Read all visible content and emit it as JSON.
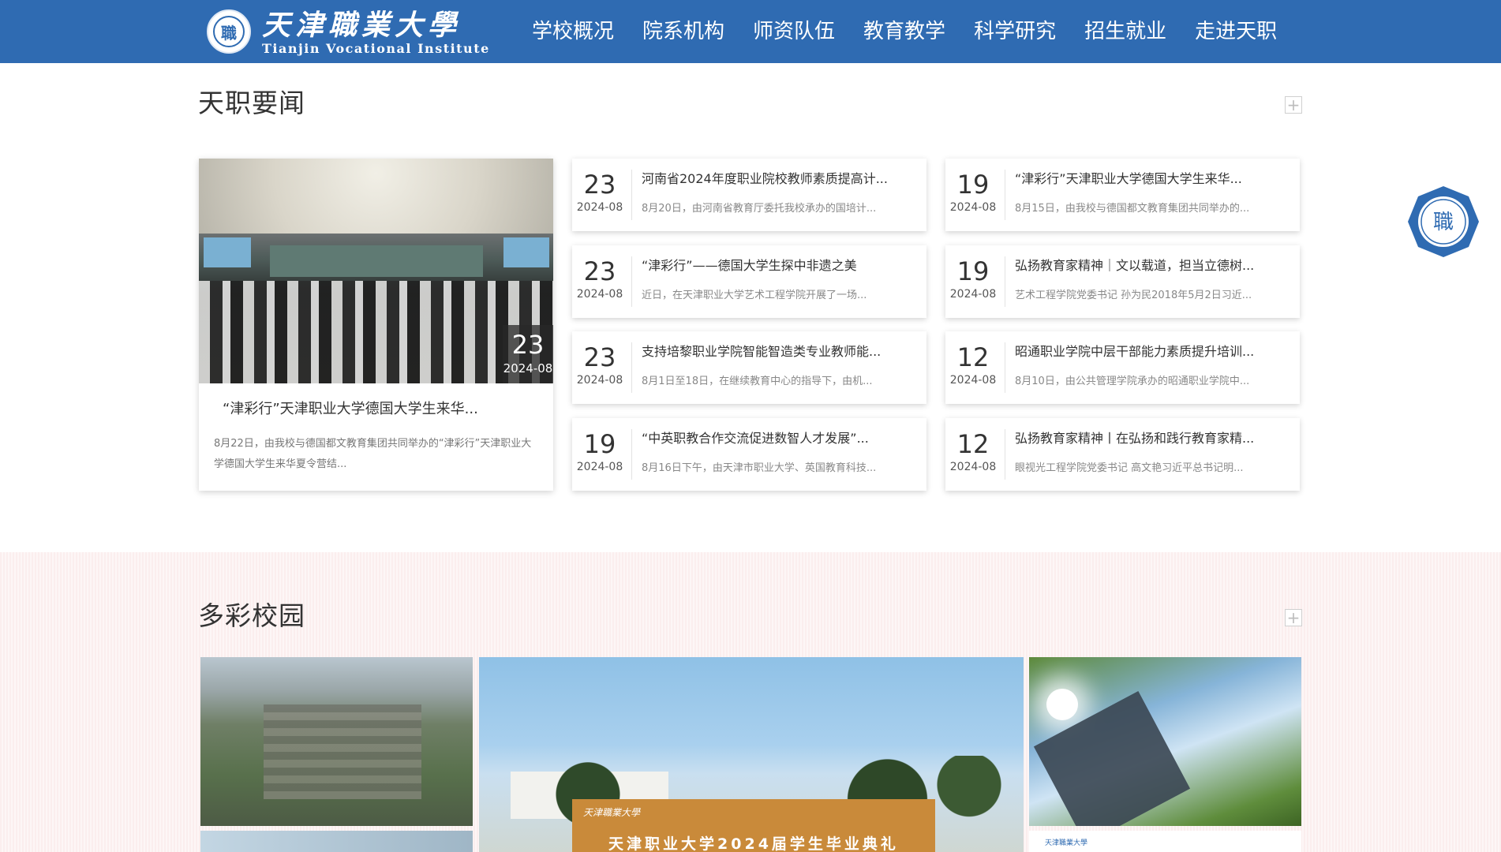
{
  "header": {
    "logo_cn": "天津職業大學",
    "logo_en": "Tianjin Vocational Institute",
    "logo_seal_char": "職",
    "nav": [
      "学校概况",
      "院系机构",
      "师资队伍",
      "教育教学",
      "科学研究",
      "招生就业",
      "走进天职"
    ]
  },
  "news_section": {
    "title": "天职要闻",
    "more": "+",
    "featured": {
      "day": "23",
      "month": "2024-08",
      "title": "“津彩行”天津职业大学德国大学生来华...",
      "summary": "8月22日，由我校与德国都文教育集团共同举办的“津彩行”天津职业大学德国大学生来华夏令营结..."
    },
    "col1": [
      {
        "day": "23",
        "month": "2024-08",
        "title": "河南省2024年度职业院校教师素质提高计...",
        "summary": "8月20日，由河南省教育厅委托我校承办的国培计..."
      },
      {
        "day": "23",
        "month": "2024-08",
        "title": "“津彩行”——德国大学生探中非遗之美",
        "summary": "近日，在天津职业大学艺术工程学院开展了一场..."
      },
      {
        "day": "23",
        "month": "2024-08",
        "title": "支持培黎职业学院智能智造类专业教师能...",
        "summary": "8月1日至18日，在继续教育中心的指导下，由机..."
      },
      {
        "day": "19",
        "month": "2024-08",
        "title": "“中英职教合作交流促进数智人才发展”...",
        "summary": "8月16日下午，由天津市职业大学、英国教育科技..."
      }
    ],
    "col2": [
      {
        "day": "19",
        "month": "2024-08",
        "title": "“津彩行”天津职业大学德国大学生来华...",
        "summary": "8月15日，由我校与德国都文教育集团共同举办的..."
      },
      {
        "day": "19",
        "month": "2024-08",
        "title": "弘扬教育家精神｜文以载道，担当立德树...",
        "summary": "艺术工程学院党委书记 孙为民2018年5月2日习近..."
      },
      {
        "day": "12",
        "month": "2024-08",
        "title": "昭通职业学院中层干部能力素质提升培训...",
        "summary": "8月10日，由公共管理学院承办的昭通职业学院中..."
      },
      {
        "day": "12",
        "month": "2024-08",
        "title": "弘扬教育家精神丨在弘扬和践行教育家精...",
        "summary": "眼视光工程学院党委书记 高文艳习近平总书记明..."
      }
    ]
  },
  "campus_section": {
    "title": "多彩校园",
    "more": "+",
    "banner_title": "天津职业大学2024届学生毕业典礼",
    "banner_script": "天津職業大學"
  },
  "float_badge_char": "職",
  "colors": {
    "header_bg": "#2f6bb2",
    "campus_bg": "#fbeeee"
  }
}
